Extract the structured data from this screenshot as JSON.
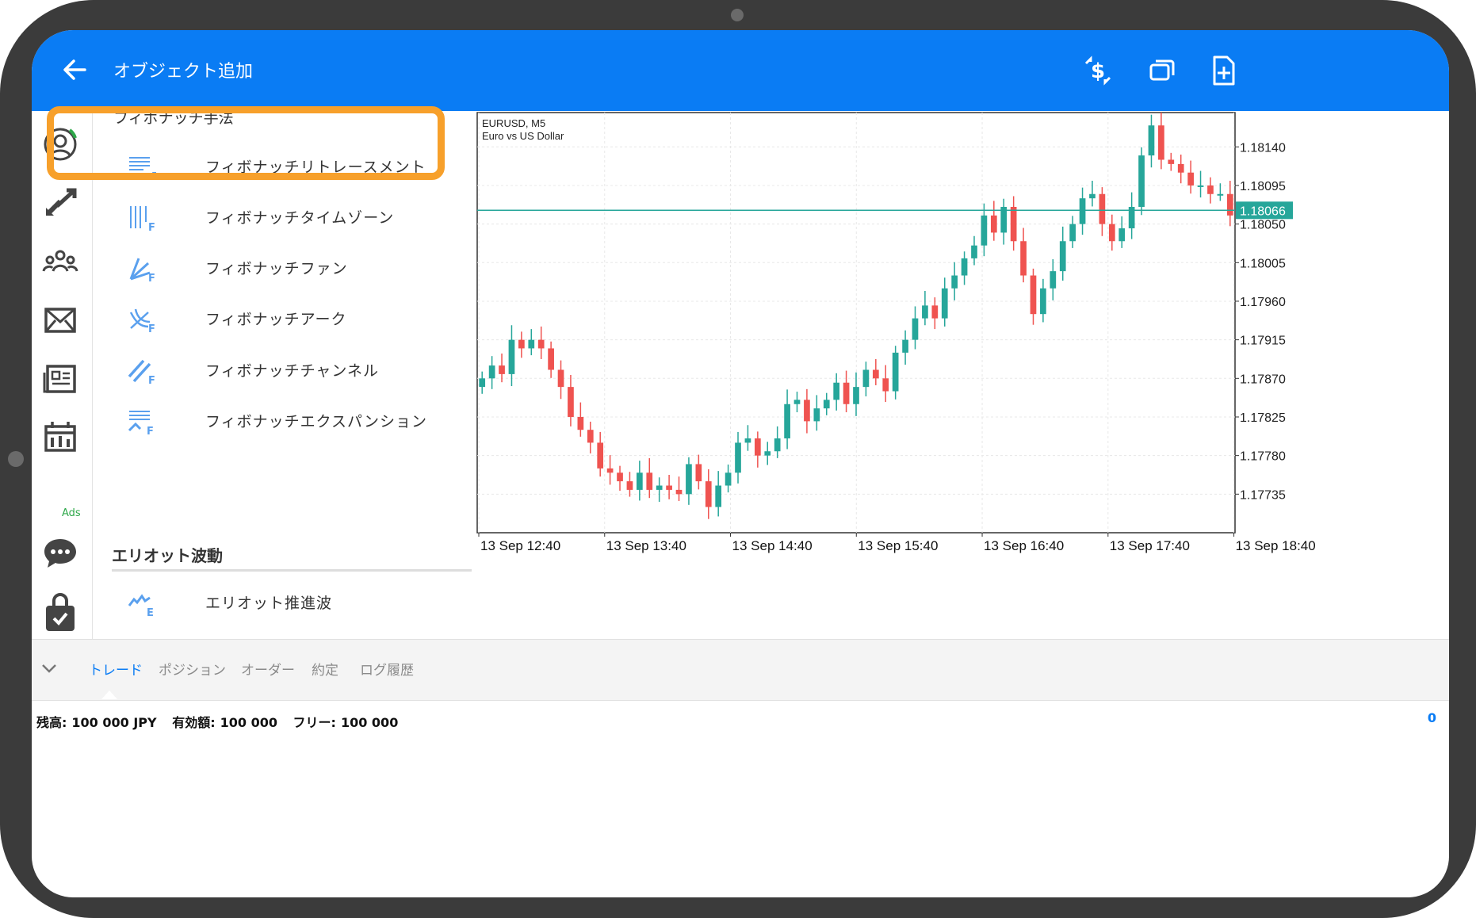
{
  "appbar": {
    "title": "オブジェクト追加"
  },
  "rail": {
    "ads_label": "Ads"
  },
  "list": {
    "clipped_header": "フィボナッチ手法",
    "items": [
      {
        "label": "フィボナッチリトレースメント",
        "icon": "fibo-retracement-icon"
      },
      {
        "label": "フィボナッチタイムゾーン",
        "icon": "fibo-timezone-icon"
      },
      {
        "label": "フィボナッチファン",
        "icon": "fibo-fan-icon"
      },
      {
        "label": "フィボナッチアーク",
        "icon": "fibo-arc-icon"
      },
      {
        "label": "フィボナッチチャンネル",
        "icon": "fibo-channel-icon"
      },
      {
        "label": "フィボナッチエクスパンション",
        "icon": "fibo-expansion-icon"
      }
    ],
    "section_title": "エリオット波動",
    "section_items": [
      {
        "label": "エリオット推進波",
        "icon": "elliott-impulse-icon"
      }
    ],
    "highlight_color": "#f7a02b"
  },
  "chart_data": {
    "type": "candlestick",
    "symbol": "EURUSD, M5",
    "description": "Euro vs US Dollar",
    "price_ticks": [
      "1.18140",
      "1.18095",
      "1.18050",
      "1.18005",
      "1.17960",
      "1.17915",
      "1.17870",
      "1.17825",
      "1.17780",
      "1.17735"
    ],
    "time_ticks": [
      "13 Sep 12:40",
      "13 Sep 13:40",
      "13 Sep 14:40",
      "13 Sep 15:40",
      "13 Sep 16:40",
      "13 Sep 17:40",
      "13 Sep 18:40"
    ],
    "ylim": [
      1.1769,
      1.1818
    ],
    "current_price": "1.18066",
    "colors": {
      "up": "#26a69a",
      "down": "#ef5350",
      "line": "#26a69a"
    },
    "closes": [
      1.1787,
      1.17885,
      1.17875,
      1.17915,
      1.17905,
      1.17915,
      1.17905,
      1.1788,
      1.1786,
      1.17825,
      1.1781,
      1.17795,
      1.17765,
      1.1776,
      1.1775,
      1.1774,
      1.1776,
      1.1774,
      1.17745,
      1.1774,
      1.17735,
      1.1777,
      1.1775,
      1.1772,
      1.17745,
      1.1776,
      1.17795,
      1.178,
      1.1778,
      1.17785,
      1.178,
      1.1784,
      1.17845,
      1.1782,
      1.17835,
      1.17845,
      1.17865,
      1.1784,
      1.1786,
      1.1788,
      1.1787,
      1.17855,
      1.179,
      1.17915,
      1.1794,
      1.17955,
      1.1794,
      1.17975,
      1.1799,
      1.1801,
      1.18025,
      1.1806,
      1.1804,
      1.1807,
      1.1803,
      1.1799,
      1.17945,
      1.17975,
      1.17995,
      1.1803,
      1.1805,
      1.1808,
      1.18085,
      1.1805,
      1.1803,
      1.18045,
      1.1807,
      1.1813,
      1.18165,
      1.18125,
      1.1812,
      1.1811,
      1.18095,
      1.18095,
      1.18085,
      1.18085,
      1.1806
    ]
  },
  "tabs": {
    "items": [
      "トレード",
      "ポジション",
      "オーダー",
      "約定",
      "ログ履歴"
    ],
    "active": "トレード"
  },
  "account": {
    "balance_label": "残高:",
    "balance_value": "100 000 JPY",
    "equity_label": "有効額:",
    "equity_value": "100 000",
    "free_label": "フリー:",
    "free_value": "100 000",
    "right_value": "0"
  }
}
